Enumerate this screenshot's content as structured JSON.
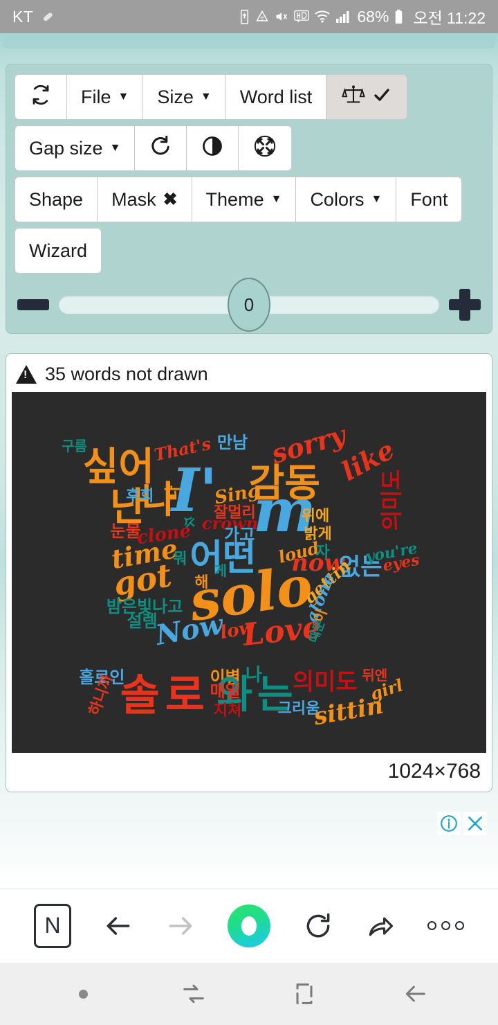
{
  "statusbar": {
    "carrier": "KT",
    "icons": [
      "pill-icon",
      "battery-saver-icon",
      "data-saver-icon",
      "mute-icon",
      "hd-icon",
      "wifi-icon",
      "signal-icon"
    ],
    "battery_percent": "68%",
    "time": "오전 11:22"
  },
  "toolbar": {
    "row1": [
      {
        "label": "",
        "icon": "refresh-icon",
        "name": "refresh-button",
        "pressed": false
      },
      {
        "label": "File",
        "caret": true,
        "name": "file-menu-button",
        "pressed": false
      },
      {
        "label": "Size",
        "caret": true,
        "name": "size-menu-button",
        "pressed": false
      },
      {
        "label": "Word list",
        "caret": false,
        "name": "word-list-button",
        "pressed": false
      },
      {
        "label": "",
        "icon": "balance-check-icon",
        "name": "balance-toggle-button",
        "pressed": true
      }
    ],
    "row2": [
      {
        "label": "Gap size",
        "caret": true,
        "name": "gap-size-menu-button"
      },
      {
        "label": "",
        "icon": "rotate-icon",
        "name": "rotate-button"
      },
      {
        "label": "",
        "icon": "contrast-icon",
        "name": "contrast-button"
      },
      {
        "label": "",
        "icon": "scatter-icon",
        "name": "scatter-button"
      }
    ],
    "row3": [
      {
        "label": "Shape",
        "caret": false,
        "name": "shape-button"
      },
      {
        "label": "Mask",
        "xmark": true,
        "name": "mask-button"
      },
      {
        "label": "Theme",
        "caret": true,
        "name": "theme-menu-button"
      },
      {
        "label": "Colors",
        "caret": true,
        "name": "colors-menu-button"
      },
      {
        "label": "Font",
        "caret": false,
        "name": "font-button"
      }
    ],
    "row4": [
      {
        "label": "Wizard",
        "caret": false,
        "name": "wizard-button"
      }
    ]
  },
  "slider": {
    "value": "0",
    "minus_label": "minus-icon",
    "plus_label": "plus-icon"
  },
  "cloud_card": {
    "warning_text": "35 words not drawn",
    "dimensions": "1024×768",
    "background": "#2b2b2b"
  },
  "ad": {
    "info_icon": "ad-info-icon",
    "close_icon": "ad-close-icon",
    "accent": "#1fa8c4"
  },
  "browser": {
    "logo": "N",
    "items": [
      "naver-logo",
      "back-arrow-icon",
      "forward-arrow-icon",
      "home-circle-icon",
      "reload-icon",
      "share-icon",
      "more-icon"
    ]
  },
  "android_nav": {
    "items": [
      "notification-dot",
      "recents-icon",
      "home-icon",
      "back-icon"
    ]
  },
  "chart_data": {
    "type": "wordcloud",
    "title": "35 words not drawn",
    "canvas_size": "1024×768",
    "background": "#2b2b2b",
    "palette": {
      "orange": "#f39019",
      "blue": "#4aa8e0",
      "red": "#e8341c",
      "teal": "#0f8f83",
      "darkred": "#c41010",
      "gold": "#f5a623"
    },
    "words": [
      {
        "text": "구름",
        "x": 13.2,
        "y": 15.0,
        "size": 20,
        "color": "#0f8f83",
        "rot": 0
      },
      {
        "text": "싶어",
        "x": 22.5,
        "y": 21.0,
        "size": 56,
        "color": "#f39019",
        "rot": 0
      },
      {
        "text": "That's",
        "x": 36.0,
        "y": 16.0,
        "size": 24,
        "color": "#e8341c",
        "rot": -12
      },
      {
        "text": "만남",
        "x": 46.5,
        "y": 14.0,
        "size": 24,
        "color": "#4aa8e0",
        "rot": 0
      },
      {
        "text": "sorry",
        "x": 62.5,
        "y": 14.5,
        "size": 38,
        "color": "#e8341c",
        "rot": -16
      },
      {
        "text": "like",
        "x": 75.0,
        "y": 19.0,
        "size": 38,
        "color": "#e8341c",
        "rot": -28
      },
      {
        "text": "I'",
        "x": 38.5,
        "y": 27.5,
        "size": 86,
        "color": "#4aa8e0",
        "rot": 0
      },
      {
        "text": "감동",
        "x": 57.5,
        "y": 25.5,
        "size": 56,
        "color": "#f39019",
        "rot": 0
      },
      {
        "text": "난",
        "x": 24.5,
        "y": 32.0,
        "size": 56,
        "color": "#f39019",
        "rot": 0
      },
      {
        "text": "나",
        "x": 31.0,
        "y": 30.0,
        "size": 54,
        "color": "#f39019",
        "rot": 0
      },
      {
        "text": "후회",
        "x": 27.0,
        "y": 29.0,
        "size": 22,
        "color": "#4aa8e0",
        "rot": 0
      },
      {
        "text": "다",
        "x": 34.0,
        "y": 28.0,
        "size": 24,
        "color": "#f39019",
        "rot": -90
      },
      {
        "text": "Sing",
        "x": 47.5,
        "y": 28.5,
        "size": 26,
        "color": "#f39019",
        "rot": -10
      },
      {
        "text": "m",
        "x": 57.5,
        "y": 33.0,
        "size": 86,
        "color": "#4aa8e0",
        "rot": 0
      },
      {
        "text": "잘멀리",
        "x": 47.0,
        "y": 33.5,
        "size": 22,
        "color": "#e8341c",
        "rot": 0
      },
      {
        "text": "crown",
        "x": 46.0,
        "y": 36.5,
        "size": 24,
        "color": "#c41010",
        "rot": 0
      },
      {
        "text": "가고",
        "x": 48.0,
        "y": 39.5,
        "size": 24,
        "color": "#4aa8e0",
        "rot": 0
      },
      {
        "text": "수",
        "x": 37.5,
        "y": 36.0,
        "size": 20,
        "color": "#0f8f83",
        "rot": -50
      },
      {
        "text": "눈물",
        "x": 24.0,
        "y": 38.5,
        "size": 24,
        "color": "#e8341c",
        "rot": 0
      },
      {
        "text": "clone",
        "x": 32.0,
        "y": 39.5,
        "size": 26,
        "color": "#c41010",
        "rot": -8
      },
      {
        "text": "위에",
        "x": 64.0,
        "y": 34.5,
        "size": 22,
        "color": "#f5a623",
        "rot": 0
      },
      {
        "text": "밝게",
        "x": 64.5,
        "y": 39.5,
        "size": 22,
        "color": "#f5a623",
        "rot": 0
      },
      {
        "text": "의미도",
        "x": 80.0,
        "y": 30.0,
        "size": 32,
        "color": "#c41010",
        "rot": -90
      },
      {
        "text": "time",
        "x": 28.0,
        "y": 45.0,
        "size": 38,
        "color": "#f39019",
        "rot": -10
      },
      {
        "text": "뭐",
        "x": 35.5,
        "y": 46.5,
        "size": 22,
        "color": "#0f8f83",
        "rot": 0
      },
      {
        "text": "어떤",
        "x": 44.5,
        "y": 46.0,
        "size": 52,
        "color": "#4aa8e0",
        "rot": 0
      },
      {
        "text": "게",
        "x": 44.0,
        "y": 49.5,
        "size": 20,
        "color": "#0f8f83",
        "rot": 0
      },
      {
        "text": "loud",
        "x": 60.5,
        "y": 44.5,
        "size": 24,
        "color": "#f39019",
        "rot": -14
      },
      {
        "text": "자",
        "x": 65.5,
        "y": 44.5,
        "size": 22,
        "color": "#0f8f83",
        "rot": 0
      },
      {
        "text": "now",
        "x": 64.5,
        "y": 47.5,
        "size": 34,
        "color": "#e8341c",
        "rot": 0
      },
      {
        "text": "없는",
        "x": 73.5,
        "y": 48.5,
        "size": 34,
        "color": "#4aa8e0",
        "rot": 0
      },
      {
        "text": "you're",
        "x": 80.0,
        "y": 44.5,
        "size": 22,
        "color": "#0f8f83",
        "rot": -10
      },
      {
        "text": "eyes",
        "x": 82.0,
        "y": 47.5,
        "size": 22,
        "color": "#e8341c",
        "rot": -10
      },
      {
        "text": "got",
        "x": 27.5,
        "y": 52.0,
        "size": 46,
        "color": "#f39019",
        "rot": -10
      },
      {
        "text": "해",
        "x": 40.0,
        "y": 53.0,
        "size": 22,
        "color": "#f39019",
        "rot": 0
      },
      {
        "text": "solo",
        "x": 50.5,
        "y": 56.0,
        "size": 78,
        "color": "#f39019",
        "rot": -8
      },
      {
        "text": "gettin",
        "x": 66.5,
        "y": 52.5,
        "size": 24,
        "color": "#f5a623",
        "rot": -42
      },
      {
        "text": "alone",
        "x": 65.0,
        "y": 57.0,
        "size": 24,
        "color": "#4aa8e0",
        "rot": -68
      },
      {
        "text": "이",
        "x": 65.0,
        "y": 62.0,
        "size": 20,
        "color": "#f39019",
        "rot": -70
      },
      {
        "text": "밤은빛나고",
        "x": 28.0,
        "y": 59.5,
        "size": 24,
        "color": "#0f8f83",
        "rot": 0
      },
      {
        "text": "설렘",
        "x": 27.5,
        "y": 63.5,
        "size": 24,
        "color": "#0f8f83",
        "rot": 0
      },
      {
        "text": "Now",
        "x": 37.5,
        "y": 66.0,
        "size": 40,
        "color": "#4aa8e0",
        "rot": -10
      },
      {
        "text": "low",
        "x": 47.5,
        "y": 66.0,
        "size": 26,
        "color": "#e8341c",
        "rot": -10
      },
      {
        "text": "Love",
        "x": 57.0,
        "y": 66.5,
        "size": 44,
        "color": "#e8341c",
        "rot": -6
      },
      {
        "text": "때문",
        "x": 64.5,
        "y": 66.5,
        "size": 18,
        "color": "#0f8f83",
        "rot": -70
      },
      {
        "text": "홀로인",
        "x": 19.0,
        "y": 79.0,
        "size": 24,
        "color": "#4aa8e0",
        "rot": 0
      },
      {
        "text": "하니까",
        "x": 19.0,
        "y": 84.0,
        "size": 22,
        "color": "#e8341c",
        "rot": -70
      },
      {
        "text": "솔",
        "x": 27.0,
        "y": 84.0,
        "size": 62,
        "color": "#e8341c",
        "rot": 0
      },
      {
        "text": "로",
        "x": 36.5,
        "y": 84.0,
        "size": 62,
        "color": "#e8341c",
        "rot": 0
      },
      {
        "text": "이별",
        "x": 45.0,
        "y": 79.0,
        "size": 24,
        "color": "#f39019",
        "rot": 0
      },
      {
        "text": "나",
        "x": 51.0,
        "y": 78.5,
        "size": 26,
        "color": "#0f8f83",
        "rot": 0
      },
      {
        "text": "와",
        "x": 47.0,
        "y": 84.0,
        "size": 56,
        "color": "#0f8f83",
        "rot": 0
      },
      {
        "text": "매일",
        "x": 45.0,
        "y": 83.0,
        "size": 24,
        "color": "#e8341c",
        "rot": 0
      },
      {
        "text": "는",
        "x": 55.5,
        "y": 84.0,
        "size": 56,
        "color": "#0f8f83",
        "rot": 0
      },
      {
        "text": "지쳐",
        "x": 45.5,
        "y": 88.5,
        "size": 22,
        "color": "#c41010",
        "rot": 0
      },
      {
        "text": "의미도",
        "x": 66.0,
        "y": 80.5,
        "size": 34,
        "color": "#c41010",
        "rot": 0
      },
      {
        "text": "뒤엔",
        "x": 76.5,
        "y": 78.5,
        "size": 20,
        "color": "#e8341c",
        "rot": 0
      },
      {
        "text": "girl",
        "x": 79.0,
        "y": 82.5,
        "size": 24,
        "color": "#f39019",
        "rot": -18
      },
      {
        "text": "그리움",
        "x": 60.5,
        "y": 88.0,
        "size": 22,
        "color": "#4aa8e0",
        "rot": 0
      },
      {
        "text": "sittin",
        "x": 71.0,
        "y": 88.5,
        "size": 34,
        "color": "#f39019",
        "rot": -10
      }
    ]
  }
}
